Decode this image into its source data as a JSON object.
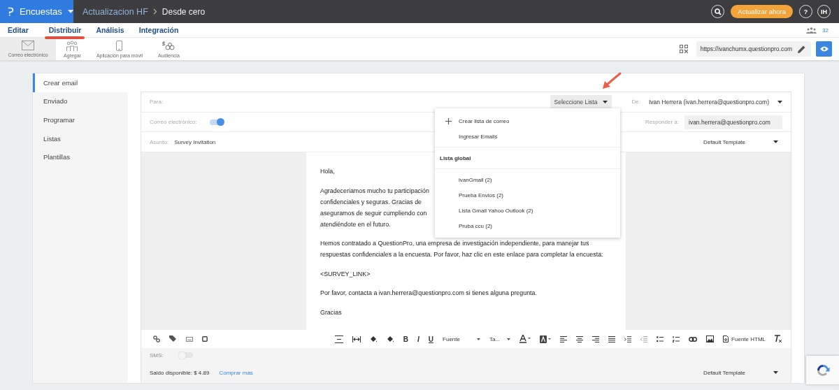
{
  "app": {
    "name": "Encuestas",
    "breadcrumb": [
      "Actualizacion HF",
      "Desde cero"
    ],
    "upgrade_button": "Actualizar ahora",
    "help": "?",
    "avatar": "IH"
  },
  "tabs": [
    {
      "label": "Editar",
      "selected": false
    },
    {
      "label": "Distribuir",
      "selected": true
    },
    {
      "label": "Análisis",
      "selected": false
    },
    {
      "label": "Integración",
      "selected": false
    }
  ],
  "participants_count": "32",
  "toolbar": [
    {
      "label": "Correo electrónico",
      "kind": "mail",
      "selected": true
    },
    {
      "label": "Agregar",
      "kind": "people",
      "selected": false
    },
    {
      "label": "Aplicación para móvil",
      "kind": "phone",
      "selected": false
    },
    {
      "label": "Audiencia",
      "kind": "audience",
      "selected": false
    }
  ],
  "survey_url": "https://ivanchumx.questionpro.com",
  "sidebar": [
    {
      "label": "Crear email",
      "selected": true
    },
    {
      "label": "Enviado",
      "selected": false
    },
    {
      "label": "Programar",
      "selected": false
    },
    {
      "label": "Listas",
      "selected": false
    },
    {
      "label": "Plantillas",
      "selected": false
    }
  ],
  "form": {
    "to_label": "Para:",
    "list_select": "Seleccione Lista",
    "from_label": "De:",
    "from_value": "Ivan Herrera (ivan.herrera@questionpro.com)",
    "email_label": "Correo electrónico:",
    "email_on": true,
    "reply_label": "Responder a:",
    "reply_value": "ivan.herrera@questionpro.com",
    "subject_label": "Asunto:",
    "subject_value": "Survey Invitation",
    "template": "Default Template"
  },
  "email_body": [
    [
      "Hola,"
    ],
    [
      "Agradeceriamos mucho tu participación",
      "confidenciales y seguras. Gracias de",
      "aseguramos de seguir cumpliendo con",
      "atendiéndote en el futuro."
    ],
    [
      "Hemos contratado a QuestionPro, una empresa de investigación independiente, para manejar tus",
      "respuestas confidenciales a la encuesta. Por favor, haz clic en este enlace para completar la encuesta:"
    ],
    [
      "<SURVEY_LINK>"
    ],
    [
      "Por favor, contacta a ivan.herrera@questionpro.com si tienes alguna pregunta."
    ],
    [
      "Gracias"
    ]
  ],
  "list_menu": {
    "actions": [
      {
        "label": "Crear lista de correo",
        "kind": "add"
      },
      {
        "label": "Ingresar Emails",
        "kind": "plain"
      }
    ],
    "section": "Lista global",
    "lists": [
      "ivanGmail (2)",
      "Prueba Envios (2)",
      "Lista Gmail Yahoo Outlook (2)",
      "Pruba ccu (2)"
    ]
  },
  "editor_toolbar": {
    "format": [
      "B",
      "I",
      "U"
    ],
    "font": "Fuente",
    "size": "Ta...",
    "html": "Fuente HTML"
  },
  "sms": {
    "label": "SMS:",
    "on": false
  },
  "footer": {
    "balance": "Saldo disponible: $ 4.89",
    "buy_link": "Comprar más",
    "template": "Default Template"
  }
}
